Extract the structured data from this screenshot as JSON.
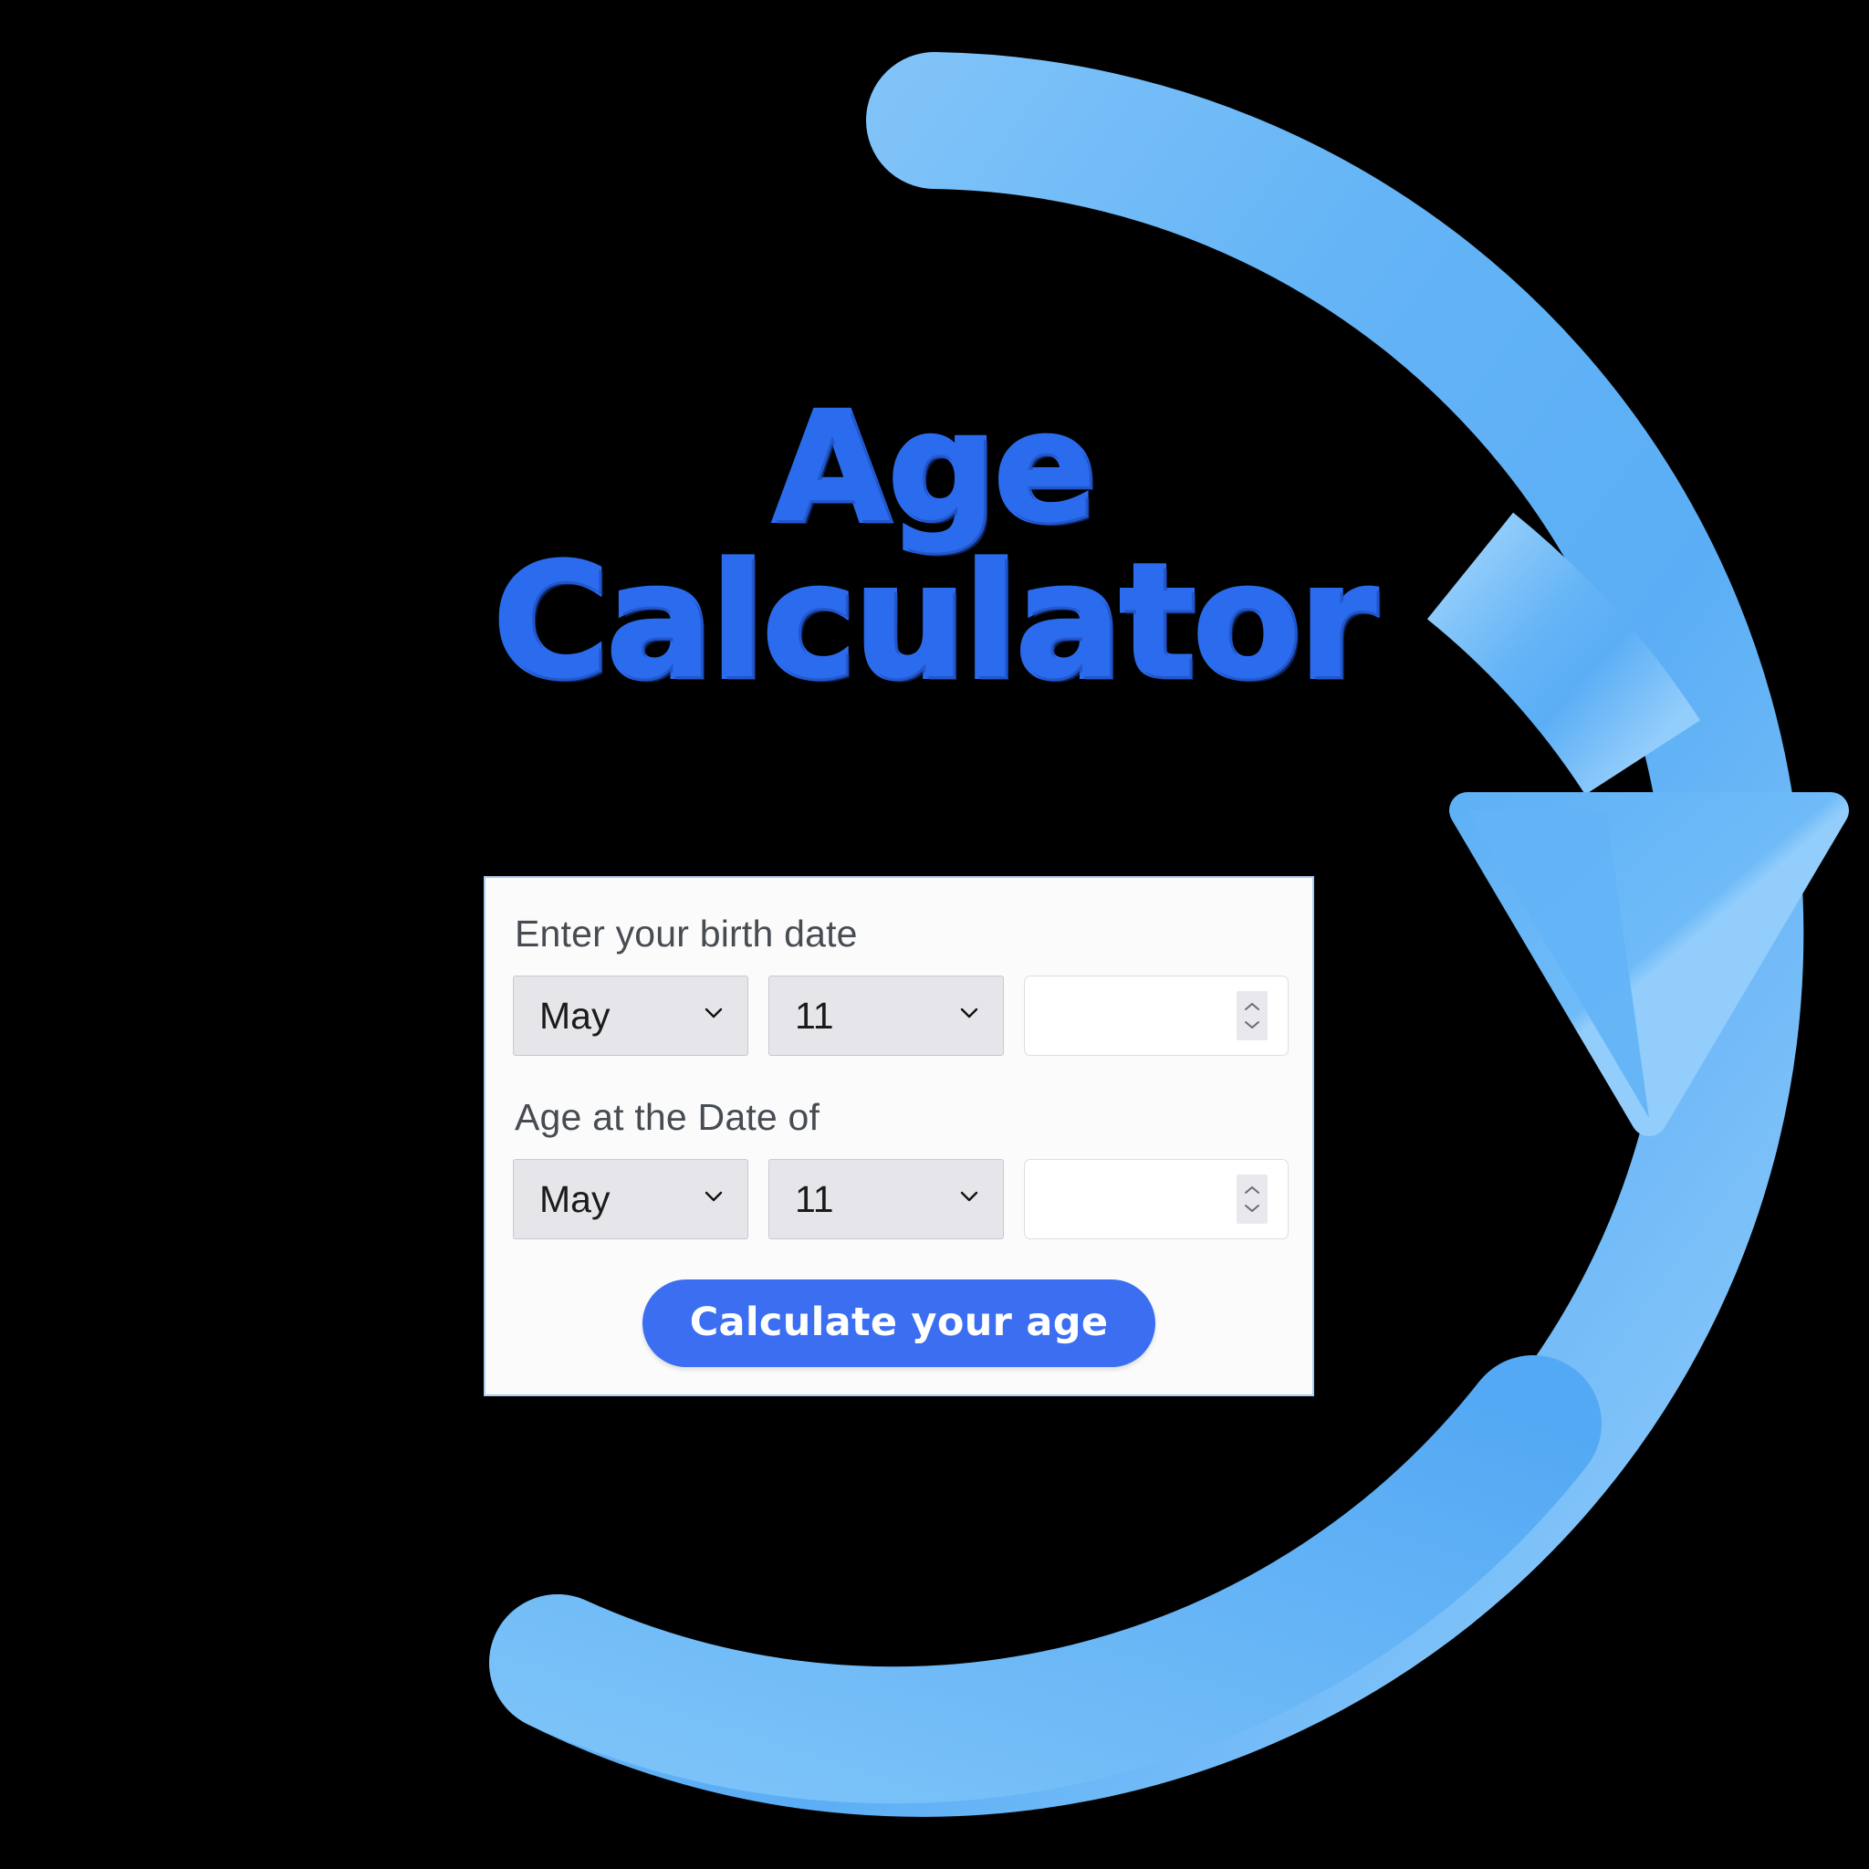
{
  "page": {
    "background_color": "#000000",
    "title_line1": "Age",
    "title_line2": "Calculator",
    "title_color": "#2B6BED"
  },
  "graphic": {
    "name": "circular-refresh-arrow",
    "ring_color_light": "#8FCBFA",
    "ring_color_mid": "#5BAEF5",
    "arrow_head_color": "#8FCBFA",
    "arrow_head_shadow": "#5BAEF5"
  },
  "card": {
    "background_color": "#FBFBFC",
    "border_color": "#A9CEF0",
    "birth_date": {
      "label": "Enter your birth date",
      "month_value": "May",
      "day_value": "11",
      "year_value": "",
      "year_placeholder": ""
    },
    "age_at_date": {
      "label": "Age at the Date of",
      "month_value": "May",
      "day_value": "11",
      "year_value": "",
      "year_placeholder": ""
    },
    "submit": {
      "label": "Calculate your age",
      "background_color": "#3B6EF0",
      "text_color": "#FFFFFF"
    }
  },
  "icons": {
    "chevron_down": "chevron-down-icon",
    "spinner_up": "spinner-up-icon",
    "spinner_down": "spinner-down-icon"
  }
}
